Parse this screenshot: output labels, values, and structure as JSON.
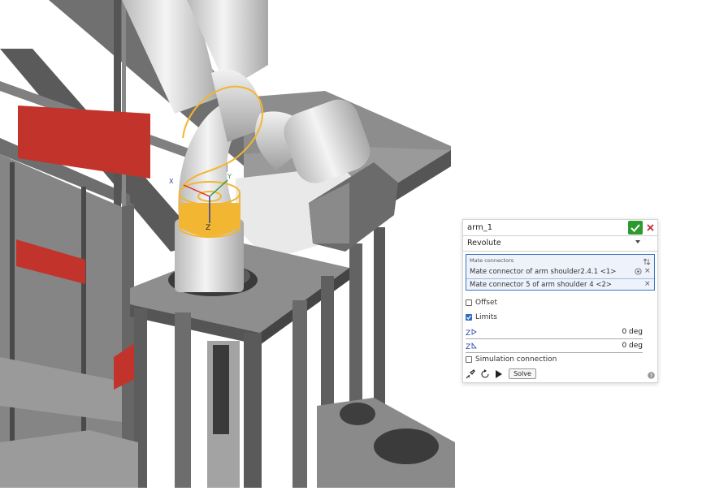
{
  "mate_dialog": {
    "feature_name": "arm_1",
    "mate_type": "Revolute",
    "connectors_title": "Mate connectors",
    "connectors": [
      {
        "label": "Mate connector of arm shoulder2.4.1 <1>"
      },
      {
        "label": "Mate connector 5 of arm shoulder 4 <2>"
      }
    ],
    "offset_label": "Offset",
    "offset_checked": false,
    "limits_label": "Limits",
    "limits_checked": true,
    "limit_min_value": "0 deg",
    "limit_max_value": "0 deg",
    "simulation_label": "Simulation connection",
    "simulation_checked": false,
    "solve_label": "Solve"
  },
  "viewport": {
    "axis_labels": {
      "x": "X",
      "y": "Y",
      "z": "Z"
    }
  },
  "colors": {
    "accept": "#2c9a2c",
    "cancel": "#c0283c",
    "selection_highlight": "#f2b632",
    "connector_border": "#3a74c4",
    "red_panel": "#c2332b"
  },
  "icons": {
    "accept": "check-icon",
    "cancel": "close-icon",
    "swap": "swap-arrows-icon",
    "limit_min": "axis-limit-min-icon",
    "limit_max": "axis-limit-max-icon",
    "animate": "animate-icon",
    "rotate": "rotate-icon",
    "play": "play-icon",
    "help": "help-icon"
  }
}
